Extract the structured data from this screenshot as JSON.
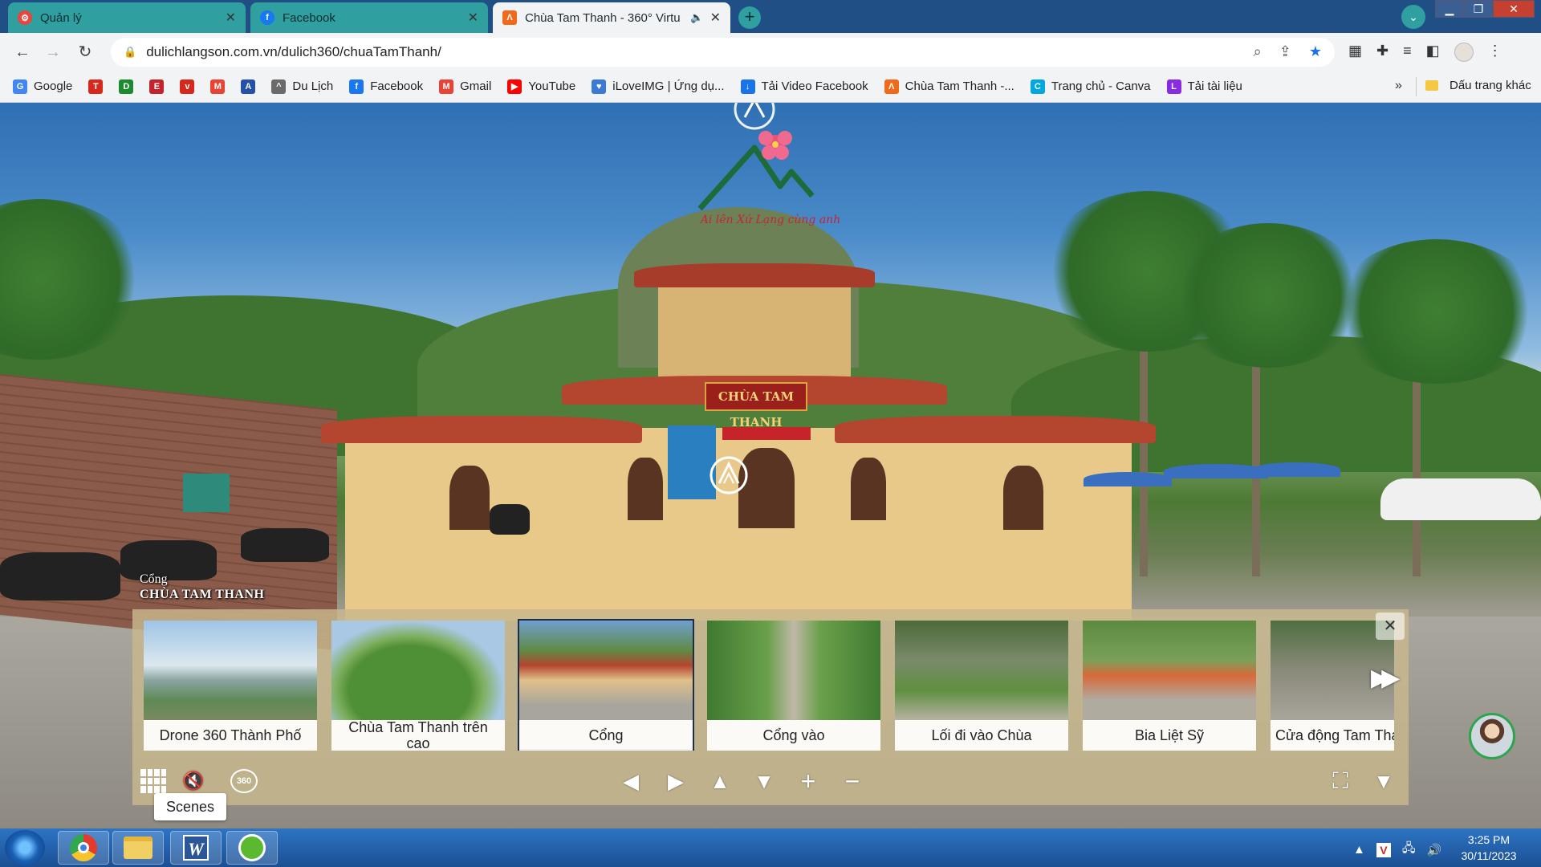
{
  "browser": {
    "tabs": [
      {
        "title": "Quản lý",
        "favicon": "settings-favicon",
        "color": "#e8453c"
      },
      {
        "title": "Facebook",
        "favicon": "facebook-favicon",
        "color": "#1877f2"
      },
      {
        "title": "Chùa Tam Thanh - 360° Virtu",
        "favicon": "tam-thanh-favicon",
        "color": "#f06a1a",
        "active": true
      }
    ],
    "new_tab_label": "+",
    "url": "dulichlangson.com.vn/dulich360/chuaTamThanh/",
    "bookmarks": [
      {
        "label": "Google",
        "icon": "google-icon",
        "color": "#4285f4",
        "glyph": "G"
      },
      {
        "label": "",
        "icon": "tp-icon",
        "color": "#d6281c",
        "glyph": "T"
      },
      {
        "label": "",
        "icon": "d-icon",
        "color": "#1c8a2e",
        "glyph": "D"
      },
      {
        "label": "",
        "icon": "e-icon",
        "color": "#c4232b",
        "glyph": "E"
      },
      {
        "label": "",
        "icon": "vov-icon",
        "color": "#d6281c",
        "glyph": "v"
      },
      {
        "label": "",
        "icon": "gmail-icon",
        "color": "#ea4335",
        "glyph": "M"
      },
      {
        "label": "",
        "icon": "a-icon",
        "color": "#2452a8",
        "glyph": "A"
      },
      {
        "label": "Du Lịch",
        "icon": "mountain-icon",
        "color": "#6b6b6b",
        "glyph": "^"
      },
      {
        "label": "Facebook",
        "icon": "facebook-icon",
        "color": "#1877f2",
        "glyph": "f"
      },
      {
        "label": "Gmail",
        "icon": "gmail-icon",
        "color": "#ea4335",
        "glyph": "M"
      },
      {
        "label": "YouTube",
        "icon": "youtube-icon",
        "color": "#ff0000",
        "glyph": "▶"
      },
      {
        "label": "iLoveIMG | Ứng dụ...",
        "icon": "heart-icon",
        "color": "#3b7bd6",
        "glyph": "♥"
      },
      {
        "label": "Tải Video Facebook",
        "icon": "download-icon",
        "color": "#1a73e8",
        "glyph": "↓"
      },
      {
        "label": "Chùa Tam Thanh -...",
        "icon": "tam-thanh-icon",
        "color": "#f06a1a",
        "glyph": "Λ"
      },
      {
        "label": "Trang chủ - Canva",
        "icon": "canva-icon",
        "color": "#00a7e1",
        "glyph": "C"
      },
      {
        "label": "Tải tài liệu",
        "icon": "document-icon",
        "color": "#8a2be2",
        "glyph": "L"
      }
    ],
    "bookmarks_more": "»",
    "other_bookmarks": "Dấu trang khác"
  },
  "tour": {
    "logo_tagline": "Ai lên Xứ Lạng cùng anh",
    "gate_sign": "CHÙA TAM THANH",
    "scene_caption": {
      "sub": "Cổng",
      "main": "CHÙA TAM THANH"
    },
    "scenes": [
      {
        "label": "Drone 360 Thành Phố",
        "selected": false
      },
      {
        "label": "Chùa Tam Thanh trên cao",
        "selected": false
      },
      {
        "label": "Cổng",
        "selected": true
      },
      {
        "label": "Cổng vào",
        "selected": false
      },
      {
        "label": "Lối đi vào Chùa",
        "selected": false
      },
      {
        "label": "Bia Liệt Sỹ",
        "selected": false
      },
      {
        "label": "Cửa động Tam Thanh",
        "selected": false
      }
    ],
    "controls": {
      "grid": "scenes-grid-icon",
      "mute": "mute-icon",
      "view360": "360",
      "left": "◀",
      "right": "▶",
      "up": "▲",
      "down": "▼",
      "zoom_in": "+",
      "zoom_out": "−"
    },
    "tooltip": "Scenes"
  },
  "taskbar": {
    "clock_time": "3:25 PM",
    "clock_date": "30/11/2023",
    "tray_v": "V"
  }
}
